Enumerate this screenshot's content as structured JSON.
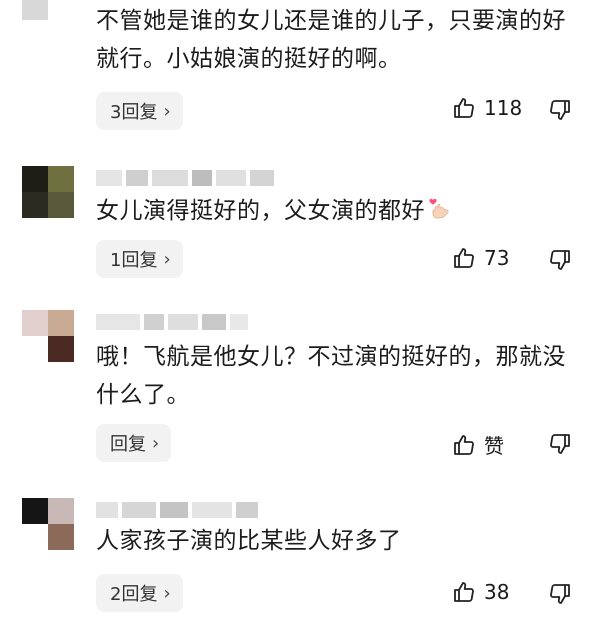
{
  "comments": [
    {
      "text": "不管她是谁的女儿还是谁的儿子，只要演的好就行。小姑娘演的挺好的啊。",
      "reply_label": "3回复",
      "like_count": "118",
      "avatar_colors": [
        "#3a3a3a",
        "#9a9a9a",
        "#d8d8d8",
        "#ffffff"
      ]
    },
    {
      "text": "女儿演得挺好的，父女演的都好",
      "reply_label": "1回复",
      "like_count": "73",
      "avatar_colors": [
        "#1e1e16",
        "#6f7040",
        "#2b2b22",
        "#57593a"
      ]
    },
    {
      "text": "哦！飞航是他女儿？不过演的挺好的，那就没什么了。",
      "reply_label": "回复",
      "like_count": "赞",
      "avatar_colors": [
        "#e2d0cf",
        "#c9ab93",
        "#ffffff",
        "#4a2a22"
      ]
    },
    {
      "text": "人家孩子演的比某些人好多了",
      "reply_label": "2回复",
      "like_count": "38",
      "avatar_colors": [
        "#151515",
        "#c9b9b6",
        "#ffffff",
        "#8b6a59"
      ]
    }
  ],
  "icons": {
    "like": "thumbs-up-icon",
    "dislike": "thumbs-down-icon",
    "chevron": "chevron-right-icon",
    "emoji": "heart-hand-emoji"
  },
  "reply_chevron": "›"
}
